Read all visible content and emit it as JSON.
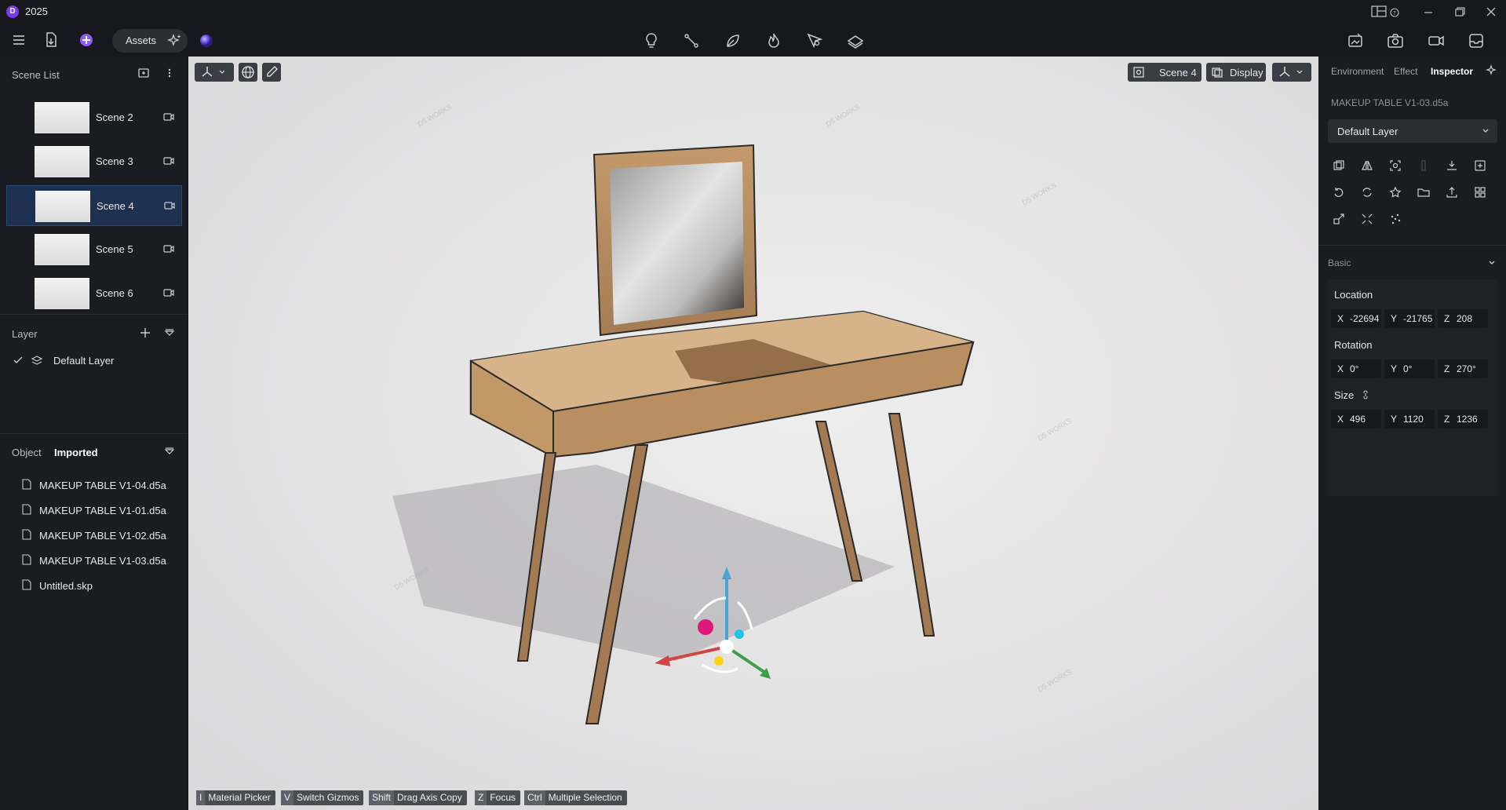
{
  "app": {
    "logo": "D",
    "title": "2025"
  },
  "toolbar": {
    "assets_label": "Assets"
  },
  "scene_list": {
    "title": "Scene List",
    "items": [
      {
        "label": "Scene 2",
        "selected": false
      },
      {
        "label": "Scene 3",
        "selected": false
      },
      {
        "label": "Scene 4",
        "selected": true
      },
      {
        "label": "Scene 5",
        "selected": false
      },
      {
        "label": "Scene 6",
        "selected": false
      }
    ]
  },
  "layer": {
    "title": "Layer",
    "default_layer": "Default Layer"
  },
  "object": {
    "title": "Object",
    "filter": "Imported",
    "files": [
      "MAKEUP TABLE V1-04.d5a",
      "MAKEUP TABLE V1-01.d5a",
      "MAKEUP TABLE V1-02.d5a",
      "MAKEUP TABLE V1-03.d5a",
      "Untitled.skp"
    ]
  },
  "viewport": {
    "scene_button": "Scene 4",
    "display_button": "Display",
    "watermark": "D5 WORKS",
    "hints": [
      {
        "key": "I",
        "label": "Material Picker"
      },
      {
        "key": "V",
        "label": "Switch Gizmos"
      },
      {
        "key": "Shift",
        "label": "Drag Axis Copy"
      },
      {
        "key": "Z",
        "label": "Focus"
      },
      {
        "key": "Ctrl",
        "label": "Multiple Selection"
      }
    ]
  },
  "inspector": {
    "tabs": [
      "Environment",
      "Effect",
      "Inspector"
    ],
    "active_tab": "Inspector",
    "object_name": "MAKEUP TABLE V1-03.d5a",
    "layer_value": "Default Layer",
    "section_title": "Basic",
    "location": {
      "label": "Location",
      "x": "-22694!",
      "y": "-21765",
      "z": "208"
    },
    "rotation": {
      "label": "Rotation",
      "x": "0°",
      "y": "0°",
      "z": "270°"
    },
    "size": {
      "label": "Size",
      "x": "496",
      "y": "1120",
      "z": "1236"
    }
  },
  "colors": {
    "accent": "#7c3aed",
    "selection": "#1f3150",
    "panel": "#1a1c21"
  }
}
